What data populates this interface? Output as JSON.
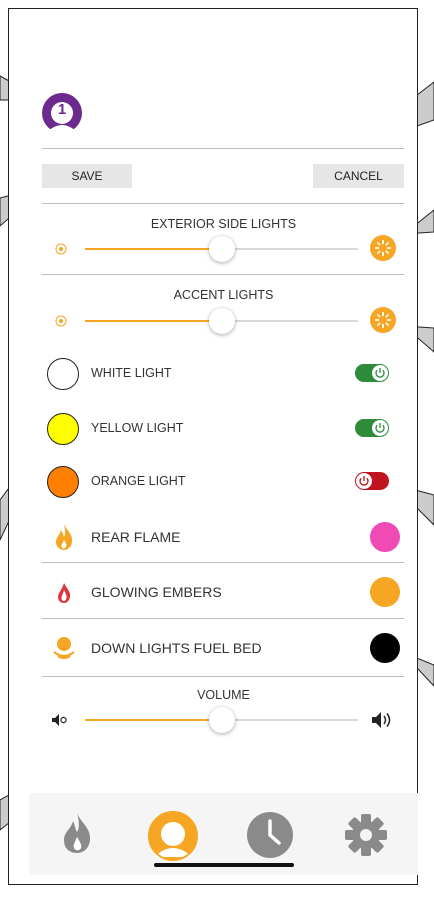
{
  "colors": {
    "accent": "#f6a623",
    "avatar": "#6b2a8c",
    "toggle_on": "#2e8b3a",
    "toggle_off": "#c0121f",
    "tab_inactive": "#8a8a8a"
  },
  "header": {
    "avatar_label": "1",
    "save_label": "SAVE",
    "cancel_label": "CANCEL"
  },
  "exterior_lights": {
    "title": "EXTERIOR SIDE LIGHTS",
    "level": 0.5
  },
  "accent_lights": {
    "title": "ACCENT LIGHTS",
    "level": 0.5
  },
  "light_toggles": [
    {
      "label": "WHITE LIGHT",
      "swatch": "#ffffff",
      "on": true
    },
    {
      "label": "YELLOW LIGHT",
      "swatch": "#ffff00",
      "on": true
    },
    {
      "label": "ORANGE LIGHT",
      "swatch": "#ff7f00",
      "on": false
    }
  ],
  "color_rows": [
    {
      "label": "REAR FLAME",
      "color": "#f04ab5",
      "icon": "flame-icon"
    },
    {
      "label": "GLOWING EMBERS",
      "color": "#f6a623",
      "icon": "ember-icon"
    },
    {
      "label": "DOWN LIGHTS FUEL BED",
      "color": "#000000",
      "icon": "downlight-icon"
    }
  ],
  "volume": {
    "title": "VOLUME",
    "level": 0.5
  },
  "tabs": [
    {
      "name": "flame-tab",
      "icon": "flame-icon",
      "active": false
    },
    {
      "name": "user-tab",
      "icon": "user-icon",
      "active": true
    },
    {
      "name": "clock-tab",
      "icon": "clock-icon",
      "active": false
    },
    {
      "name": "settings-tab",
      "icon": "gear-icon",
      "active": false
    }
  ]
}
